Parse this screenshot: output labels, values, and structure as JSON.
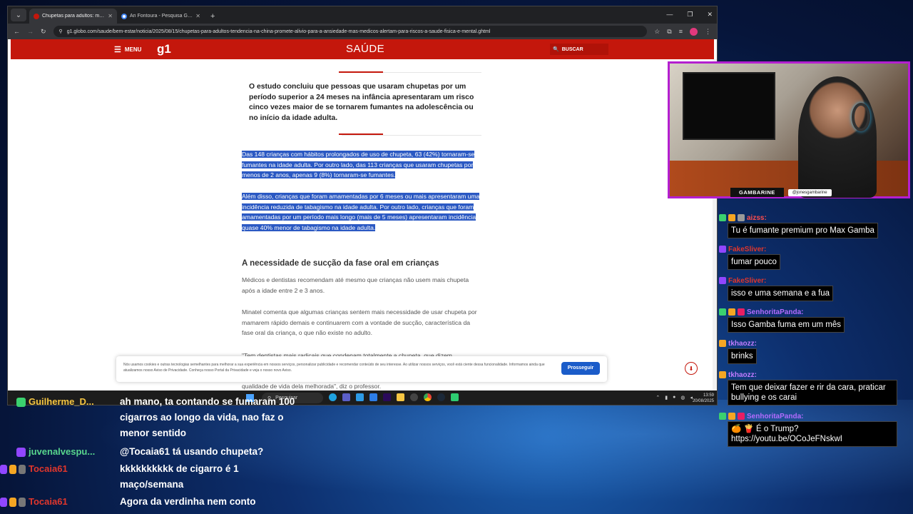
{
  "browser": {
    "tabs": [
      {
        "title": "Chupetas para adultos: médicos",
        "active": true,
        "favicon_color": "#c4170c"
      },
      {
        "title": "Ari Fontoura - Pesquisa Google",
        "active": false,
        "favicon_color": "#4285f4"
      }
    ],
    "new_tab": "+",
    "url": "g1.globo.com/saude/bem-estar/noticia/2025/08/15/chupetas-para-adultos-tendencia-na-china-promete-alivio-para-a-ansiedade-mas-medicos-alertam-para-riscos-a-saude-fisica-e-mental.ghtml"
  },
  "site": {
    "menu_label": "MENU",
    "logo": "g1",
    "section": "SAÚDE",
    "search_label": "BUSCAR",
    "accent_color": "#c4170c"
  },
  "article": {
    "pull_quote": "O estudo concluiu que pessoas que usaram chupetas por um período superior a 24 meses na infância apresentaram um risco cinco vezes maior de se tornarem fumantes na adolescência ou no início da idade adulta.",
    "selected_paragraphs": [
      "Das 148 crianças com hábitos prolongados de uso de chupeta, 63 (42%) tornaram-se fumantes na idade adulta. Por outro lado, das 113 crianças que usaram chupetas por menos de 2 anos, apenas 9 (8%) tornaram-se fumantes.",
      "Além disso, crianças que foram amamentadas por 6 meses ou mais apresentaram uma incidência reduzida de tabagismo na idade adulta. Por outro lado, crianças que foram amamentadas por um período mais longo (mais de 5 meses) apresentaram incidência quase 40% menor de tabagismo na idade adulta."
    ],
    "heading": "A necessidade de sucção da fase oral em crianças",
    "paragraphs": [
      "Médicos e dentistas recomendam até mesmo que crianças não usem mais chupeta após a idade entre 2 e 3 anos.",
      "Minatel comenta que algumas crianças sentem mais necessidade de usar chupeta por mamarem rápido demais e continuarem com a vontade de sucção, característica da fase oral da criança, o que não existe no adulto.",
      "\"Tem dentistas mais radicais que condenam totalmente a chupeta, que dizem"
    ],
    "hidden_tail": "qualidade de vida dela melhorada\", diz o professor."
  },
  "cookie_banner": {
    "text": "Nós usamos cookies e outras tecnologias semelhantes para melhorar a sua experiência em nossos serviços, personalizar publicidade e recomendar conteúdo de seu interesse. Ao utilizar nossos serviços, você está ciente dessa funcionalidade. Informamos ainda que atualizamos nosso Aviso de Privacidade. Conheça nosso Portal da Privacidade e veja o nosso novo Aviso.",
    "button": "Prosseguir"
  },
  "taskbar": {
    "search_placeholder": "Pesquisar",
    "time": "13:59",
    "date": "20/08/2025"
  },
  "stream": {
    "streamer_name": "GAMBARINE",
    "handle": "@jonesgambarine",
    "frame_color": "#b41fd0"
  },
  "right_chat": [
    {
      "user": "aizss:",
      "user_color": "#ff4d4d",
      "text": "Tu é fumante premium pro Max Gamba",
      "badges": [
        "#3bd16f",
        "#f5a623",
        "#999999"
      ]
    },
    {
      "user": "FakeSliver:",
      "user_color": "#e0362c",
      "text": "fumar pouco",
      "badges": [
        "#9146ff"
      ]
    },
    {
      "user": "FakeSliver:",
      "user_color": "#e0362c",
      "text": "isso e uma semana e a fua",
      "badges": [
        "#9146ff"
      ]
    },
    {
      "user": "SenhoritaPanda:",
      "user_color": "#b36bff",
      "text": "Isso Gamba fuma em um mês",
      "badges": [
        "#3bd16f",
        "#f5a623",
        "#e91e63"
      ]
    },
    {
      "user": "tkhaozz:",
      "user_color": "#c07bff",
      "text": "brinks",
      "badges": [
        "#f5a623"
      ]
    },
    {
      "user": "tkhaozz:",
      "user_color": "#c07bff",
      "text": "Tem que deixar fazer e rir da cara, praticar bullying e os carai",
      "badges": [
        "#f5a623"
      ]
    },
    {
      "user": "SenhoritaPanda:",
      "user_color": "#b36bff",
      "text": "🍊 🍟 É o Trump? https://youtu.be/OCoJeFNskwI",
      "badges": [
        "#3bd16f",
        "#f5a623",
        "#e91e63"
      ]
    }
  ],
  "bottom_chat": [
    {
      "user": "Guilherme_D...",
      "user_color": "#f5c542",
      "text": "ah mano, ta contando se fumaram 100 cigarros ao longo da vida, nao faz o menor sentido",
      "badges": [
        "#3bd16f"
      ]
    },
    {
      "user": "juvenalvespu...",
      "user_color": "#58d68d",
      "text": "@Tocaia61 tá usando chupeta?",
      "badges": [
        "#9146ff"
      ]
    },
    {
      "user": "Tocaia61",
      "user_color": "#e0362c",
      "text": "kkkkkkkkkk de cigarro é 1 maço/semana",
      "badges": [
        "#9146ff",
        "#f5a623",
        "#777777"
      ]
    },
    {
      "user": "Tocaia61",
      "user_color": "#e0362c",
      "text": "Agora da verdinha nem conto",
      "badges": [
        "#9146ff",
        "#f5a623",
        "#777777"
      ]
    }
  ]
}
